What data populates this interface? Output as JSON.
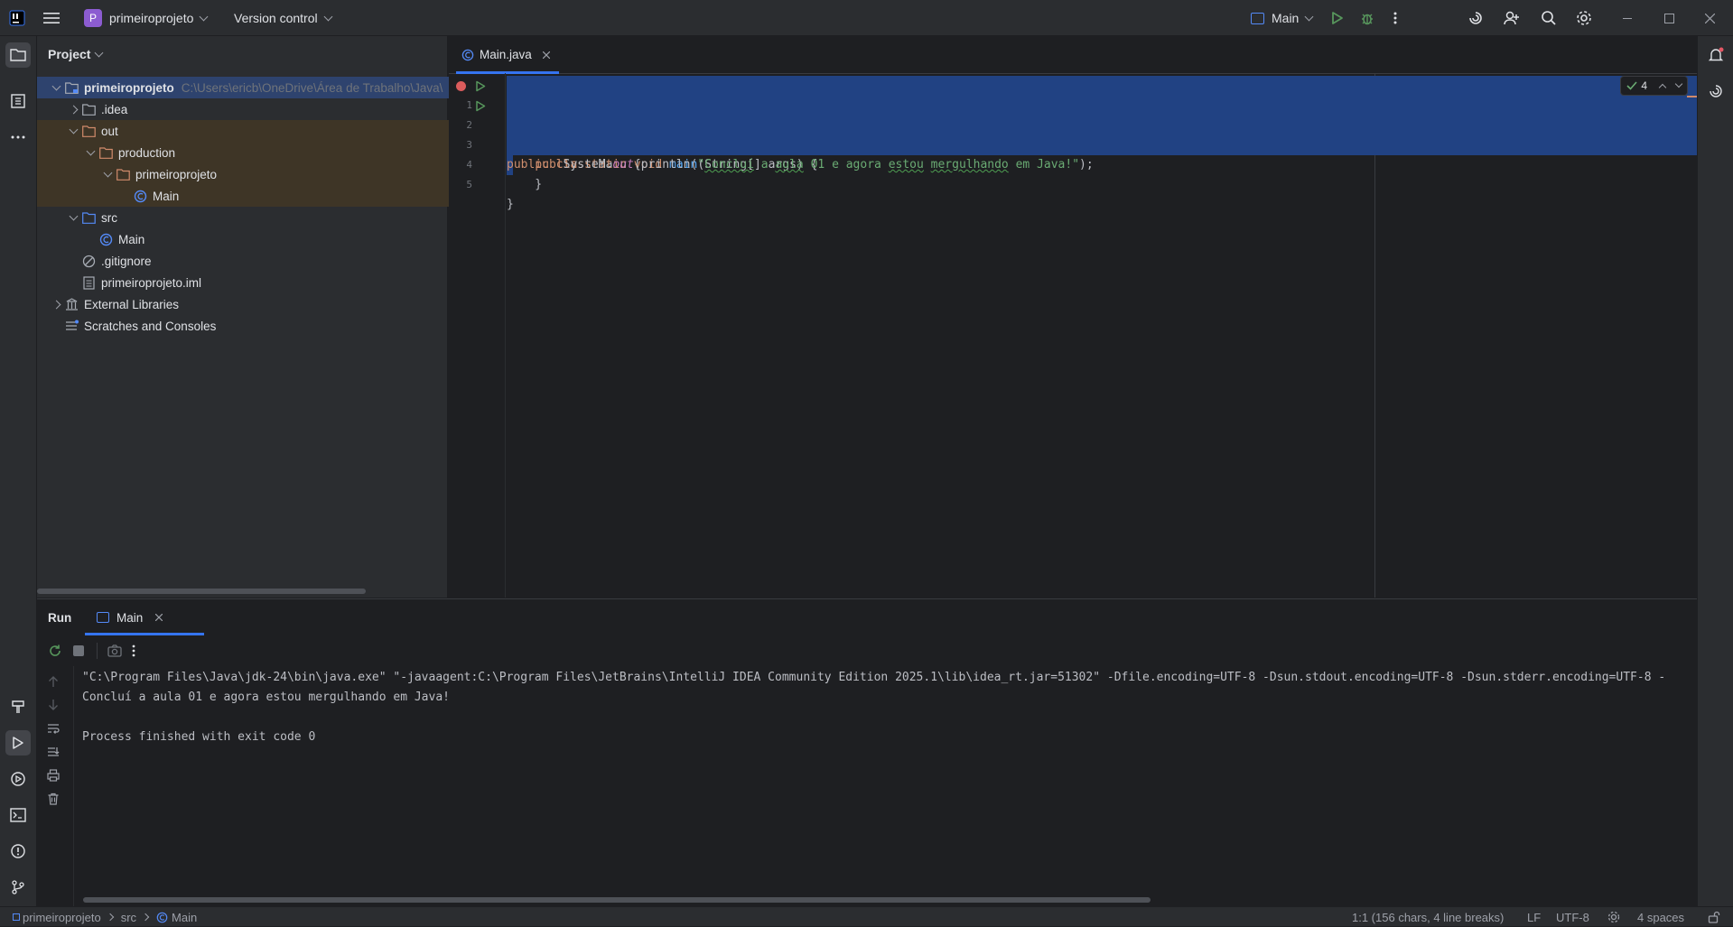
{
  "titlebar": {
    "project_badge": "P",
    "project_name": "primeiroprojeto",
    "vcs": "Version control",
    "run_config": "Main",
    "colors": {
      "badge": "#8c5cd1",
      "run": "#57965c",
      "debug": "#57965c"
    }
  },
  "project_panel": {
    "title": "Project",
    "tree": [
      {
        "label": "primeiroprojeto",
        "hint": "C:\\Users\\ericb\\OneDrive\\Área de Trabalho\\Java\\",
        "icon": "module-folder-icon",
        "expanded": true
      },
      {
        "label": ".idea",
        "icon": "folder-icon",
        "expanded": false
      },
      {
        "label": "out",
        "icon": "excluded-folder-icon",
        "expanded": true
      },
      {
        "label": "production",
        "icon": "excluded-folder-icon",
        "expanded": true
      },
      {
        "label": "primeiroprojeto",
        "icon": "excluded-folder-icon",
        "expanded": true
      },
      {
        "label": "Main",
        "icon": "class-icon"
      },
      {
        "label": "src",
        "icon": "source-folder-icon",
        "expanded": true
      },
      {
        "label": "Main",
        "icon": "class-icon"
      },
      {
        "label": ".gitignore",
        "icon": "ignore-file-icon"
      },
      {
        "label": "primeiroprojeto.iml",
        "icon": "iml-file-icon"
      },
      {
        "label": "External Libraries",
        "icon": "library-icon",
        "expanded": false
      },
      {
        "label": "Scratches and Consoles",
        "icon": "scratches-icon"
      }
    ]
  },
  "editor": {
    "tab_label": "Main.java",
    "inspection_count": "4",
    "lines": [
      {
        "num": "1"
      },
      {
        "num": "2"
      },
      {
        "num": "3"
      },
      {
        "num": "4"
      },
      {
        "num": "5"
      }
    ],
    "code": {
      "l1_kw": "public class",
      "l1_rest": " Main {",
      "l2_indent": "    ",
      "l2_kw": "public static void",
      "l2_fn": "main",
      "l2_rest": "(String[] args) {",
      "l3_pre": "        System.",
      "l3_out": "out",
      "l3_mid": ".println(",
      "l3_str_open": "\"",
      "l3_w1": "Concluí",
      "l3_s1": " a ",
      "l3_w2": "aula",
      "l3_s2": " 01 e agora ",
      "l3_w3": "estou",
      "l3_s3": " ",
      "l3_w4": "mergulhando",
      "l3_s4": " em Java!\"",
      "l3_end": ");",
      "l4": "    }",
      "l5": "}"
    }
  },
  "run_panel": {
    "tab_run": "Run",
    "tab_main": "Main",
    "console": [
      "\"C:\\Program Files\\Java\\jdk-24\\bin\\java.exe\" \"-javaagent:C:\\Program Files\\JetBrains\\IntelliJ IDEA Community Edition 2025.1\\lib\\idea_rt.jar=51302\" -Dfile.encoding=UTF-8 -Dsun.stdout.encoding=UTF-8 -Dsun.stderr.encoding=UTF-8 -",
      "Concluí a aula 01 e agora estou mergulhando em Java!",
      "",
      "Process finished with exit code 0"
    ]
  },
  "statusbar": {
    "crumb_project": "primeiroprojeto",
    "crumb_src": "src",
    "crumb_main": "Main",
    "position": "1:1 (156 chars, 4 line breaks)",
    "line_sep": "LF",
    "encoding": "UTF-8",
    "indent": "4 spaces"
  }
}
